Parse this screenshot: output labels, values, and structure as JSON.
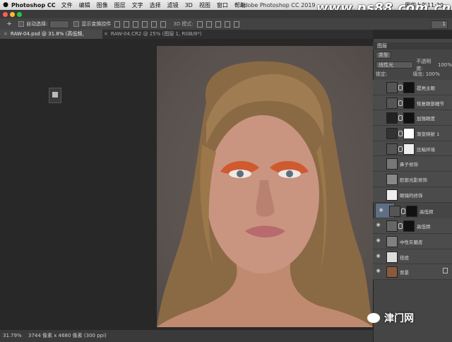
{
  "menubar": {
    "apple": "",
    "app_name": "Photoshop CC",
    "items": [
      "文件",
      "编辑",
      "图像",
      "图层",
      "文字",
      "选择",
      "滤镜",
      "3D",
      "视图",
      "窗口",
      "帮助"
    ],
    "window_title": "Adobe Photoshop CC 2019",
    "watermark": "www.ps88.com.cn",
    "clock": "周四上午11:20"
  },
  "options_bar": {
    "auto_select_label": "自动选择:",
    "show_transform_label": "显示变换控件",
    "mode_3d_label": "3D 模式:",
    "workspace_value": "1"
  },
  "tabs": [
    {
      "label": "RAW-04.psd @ 31.8% (高低频, RGB/8*)",
      "close": "×"
    },
    {
      "label": "RAW-04.CR2 @ 25% (图层 1, RGB/8*)",
      "close": "×"
    }
  ],
  "status": {
    "zoom": "31.79%",
    "doc_info": "3744 像素 x 4680 像素 (300 ppi)"
  },
  "wechat_brand": "津门网",
  "layers_panel": {
    "tab": "图层",
    "kind_filter": "类型",
    "blend_mode": "线性光",
    "opacity_label": "不透明度:",
    "opacity_value": "100%",
    "lock_label": "锁定:",
    "fill_label": "填充:",
    "fill_value": "100%",
    "layers": [
      {
        "name": "提亮主眼",
        "thumb": "#555",
        "mask": true,
        "mask_color": "#111",
        "visible": false,
        "selected": false
      },
      {
        "name": "恢复眼部细节",
        "thumb": "#555",
        "mask": true,
        "mask_color": "#111",
        "visible": false,
        "selected": false
      },
      {
        "name": "加强眼度",
        "thumb": "#222",
        "mask": true,
        "mask_color": "#111",
        "visible": false,
        "selected": false
      },
      {
        "name": "渐变映射 1",
        "thumb": "#333",
        "mask": true,
        "mask_color": "#fff",
        "visible": false,
        "selected": false
      },
      {
        "name": "压暗环境",
        "thumb": "#555",
        "mask": true,
        "mask_color": "#eee",
        "visible": false,
        "selected": false
      },
      {
        "name": "鼻子修饰",
        "thumb": "#777",
        "mask": false,
        "mask_color": "",
        "visible": false,
        "selected": false
      },
      {
        "name": "脸部光影修饰",
        "thumb": "#888",
        "mask": false,
        "mask_color": "",
        "visible": false,
        "selected": false
      },
      {
        "name": "眼镜的修饰",
        "thumb": "#eee",
        "mask": false,
        "mask_color": "",
        "visible": false,
        "selected": false
      },
      {
        "name": "高低频",
        "thumb": "#555",
        "mask": true,
        "mask_color": "#111",
        "visible": true,
        "selected": true
      },
      {
        "name": "高低频",
        "thumb": "#666",
        "mask": true,
        "mask_color": "#111",
        "visible": true,
        "selected": false
      },
      {
        "name": "中性灰磨皮",
        "thumb": "#808080",
        "mask": false,
        "mask_color": "",
        "visible": true,
        "selected": false
      },
      {
        "name": "祛痘",
        "thumb": "#ddd",
        "mask": false,
        "mask_color": "",
        "visible": true,
        "selected": false
      },
      {
        "name": "背景",
        "thumb": "#8a5a3c",
        "mask": false,
        "mask_color": "",
        "visible": true,
        "selected": false,
        "locked": true
      }
    ]
  }
}
